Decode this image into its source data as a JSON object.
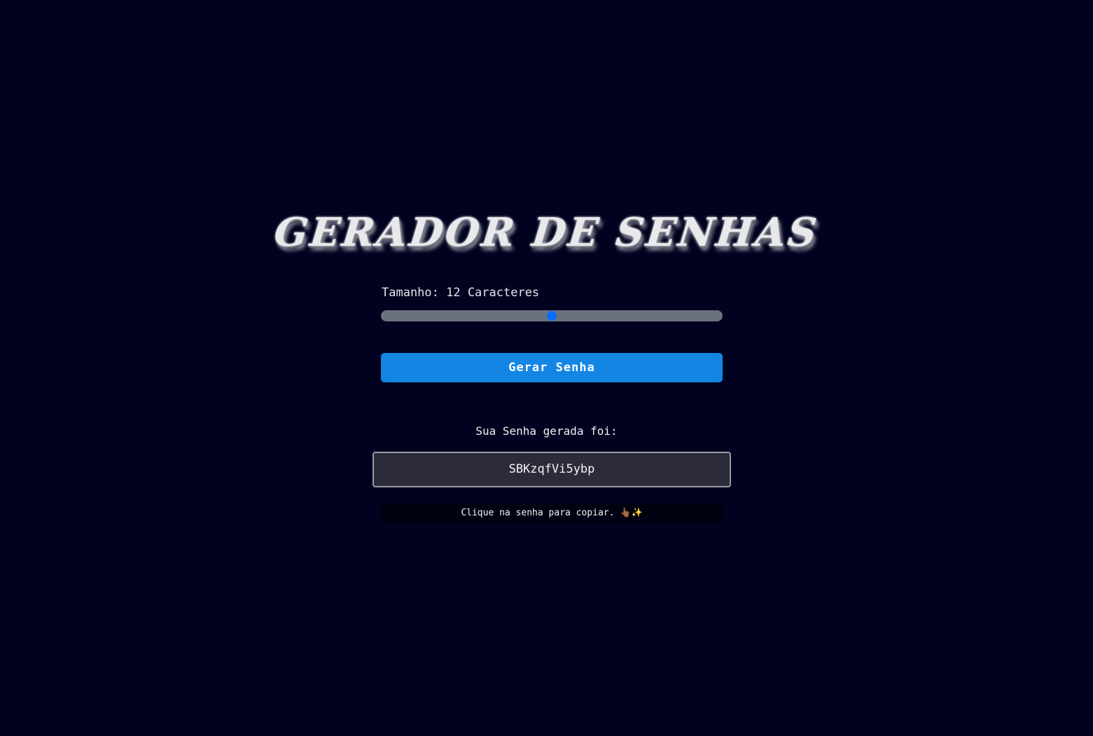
{
  "title": "GERADOR DE SENHAS",
  "length_control": {
    "label": "Tamanho: 12 Caracteres",
    "slider_fraction": 0.5
  },
  "generate_button_label": "Gerar Senha",
  "result": {
    "label": "Sua Senha gerada foi:",
    "password": "SBKzqfVi5ybp",
    "copy_hint": "Clique na senha para copiar. 👆🏾✨"
  },
  "colors": {
    "background": "#00021f",
    "button": "#1386e4",
    "slider_thumb": "#0a6ef5",
    "slider_track": "#6b717e",
    "password_box": "#2b2b3a"
  }
}
